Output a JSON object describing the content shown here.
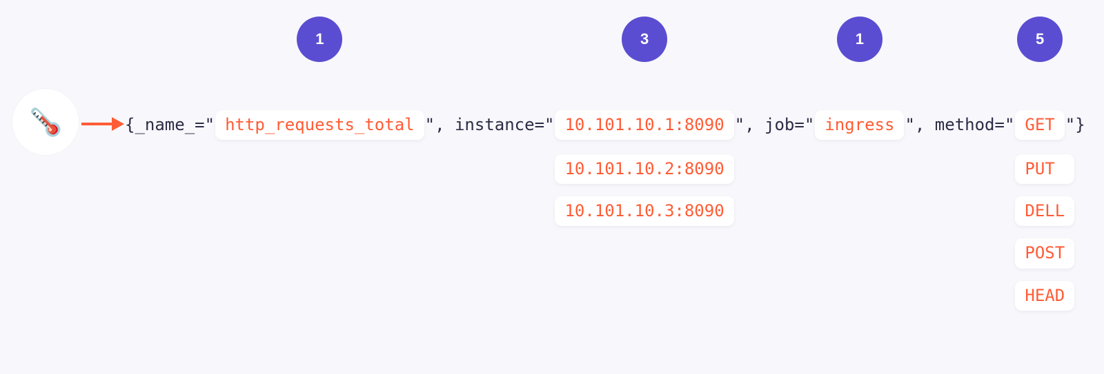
{
  "badges": {
    "name": "1",
    "instance": "3",
    "job": "1",
    "method": "5"
  },
  "labels": {
    "open_brace": "{",
    "name_key": "_name_",
    "eq": "=",
    "quote": "\"",
    "comma_sp": ", ",
    "instance_key": "instance",
    "job_key": "job",
    "method_key": "method",
    "close_brace": "}"
  },
  "values": {
    "name": "http_requests_total",
    "instances": [
      "10.101.10.1:8090",
      "10.101.10.2:8090",
      "10.101.10.3:8090"
    ],
    "job": "ingress",
    "methods": [
      "GET",
      "PUT",
      "DELL",
      "POST",
      "HEAD"
    ]
  },
  "icons": {
    "thermometer": "🌡️"
  }
}
